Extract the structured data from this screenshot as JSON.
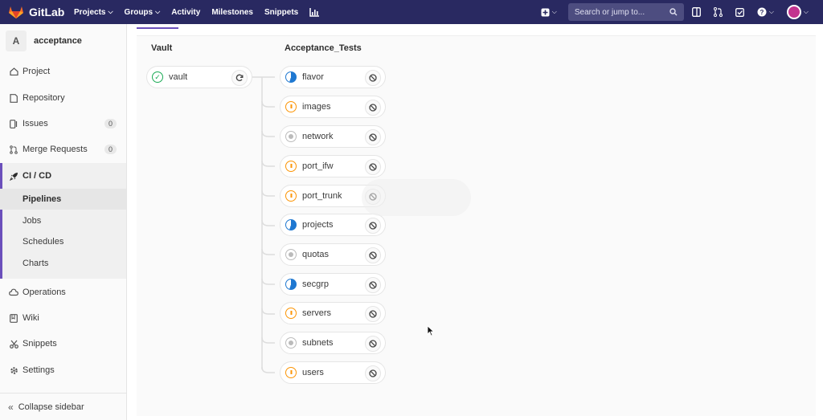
{
  "navbar": {
    "brand": "GitLab",
    "links": [
      {
        "label": "Projects",
        "dropdown": true
      },
      {
        "label": "Groups",
        "dropdown": true
      },
      {
        "label": "Activity",
        "dropdown": false
      },
      {
        "label": "Milestones",
        "dropdown": false
      },
      {
        "label": "Snippets",
        "dropdown": false
      }
    ],
    "search_placeholder": "Search or jump to...",
    "colors": {
      "navbar": "#292961",
      "accent": "#6b4fbb"
    }
  },
  "sidebar": {
    "project_initial": "A",
    "project_name": "acceptance",
    "items": [
      {
        "label": "Project",
        "icon": "home-icon"
      },
      {
        "label": "Repository",
        "icon": "doc-icon"
      },
      {
        "label": "Issues",
        "icon": "issues-icon",
        "count": "0"
      },
      {
        "label": "Merge Requests",
        "icon": "merge-request-icon",
        "count": "0"
      },
      {
        "label": "CI / CD",
        "icon": "rocket-icon"
      },
      {
        "label": "Operations",
        "icon": "cloud-icon"
      },
      {
        "label": "Wiki",
        "icon": "book-icon"
      },
      {
        "label": "Snippets",
        "icon": "scissors-icon"
      },
      {
        "label": "Settings",
        "icon": "gear-icon"
      }
    ],
    "cicd_sub": [
      "Pipelines",
      "Jobs",
      "Schedules",
      "Charts"
    ],
    "collapse_label": "Collapse sidebar"
  },
  "pipeline": {
    "stages": [
      {
        "title": "Vault",
        "jobs": [
          {
            "name": "vault",
            "status": "success",
            "action": "retry"
          }
        ]
      },
      {
        "title": "Acceptance_Tests",
        "jobs": [
          {
            "name": "flavor",
            "status": "running",
            "action": "cancel"
          },
          {
            "name": "images",
            "status": "pending",
            "action": "cancel"
          },
          {
            "name": "network",
            "status": "created",
            "action": "cancel"
          },
          {
            "name": "port_ifw",
            "status": "pending",
            "action": "cancel"
          },
          {
            "name": "port_trunk",
            "status": "pending",
            "action": "cancel"
          },
          {
            "name": "projects",
            "status": "running",
            "action": "cancel"
          },
          {
            "name": "quotas",
            "status": "created",
            "action": "cancel"
          },
          {
            "name": "secgrp",
            "status": "running",
            "action": "cancel"
          },
          {
            "name": "servers",
            "status": "pending",
            "action": "cancel"
          },
          {
            "name": "subnets",
            "status": "created",
            "action": "cancel"
          },
          {
            "name": "users",
            "status": "pending",
            "action": "cancel"
          }
        ]
      }
    ],
    "status_colors": {
      "success": "#1aaa55",
      "running": "#1f78d1",
      "pending": "#fc9403",
      "created": "#bbbbbb"
    }
  }
}
